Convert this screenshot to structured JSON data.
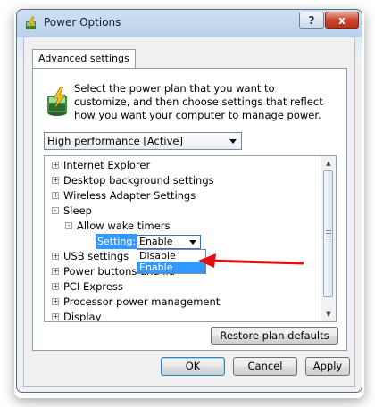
{
  "window": {
    "title": "Power Options",
    "help_label": "?",
    "close_label": "x"
  },
  "tab": {
    "label": "Advanced settings"
  },
  "description": "Select the power plan that you want to customize, and then choose settings that reflect how you want your computer to manage power.",
  "plan_select": {
    "value": "High performance [Active]"
  },
  "tree": {
    "items": [
      {
        "expander": "+",
        "label": "Internet Explorer"
      },
      {
        "expander": "+",
        "label": "Desktop background settings"
      },
      {
        "expander": "+",
        "label": "Wireless Adapter Settings"
      },
      {
        "expander": "-",
        "label": "Sleep"
      },
      {
        "expander": "-",
        "label": "Allow wake timers"
      },
      {
        "expander": "+",
        "label": "USB settings"
      },
      {
        "expander": "+",
        "label": "Power buttons and lid"
      },
      {
        "expander": "+",
        "label": "PCI Express"
      },
      {
        "expander": "+",
        "label": "Processor power management"
      },
      {
        "expander": "+",
        "label": "Display"
      }
    ],
    "setting_label": "Setting:",
    "setting_value": "Enable",
    "dropdown_options": [
      "Disable",
      "Enable"
    ],
    "selected_option": "Enable"
  },
  "buttons": {
    "restore": "Restore plan defaults",
    "ok": "OK",
    "cancel": "Cancel",
    "apply": "Apply"
  },
  "colors": {
    "highlight": "#3399ff",
    "annotation_arrow": "#e01010"
  }
}
